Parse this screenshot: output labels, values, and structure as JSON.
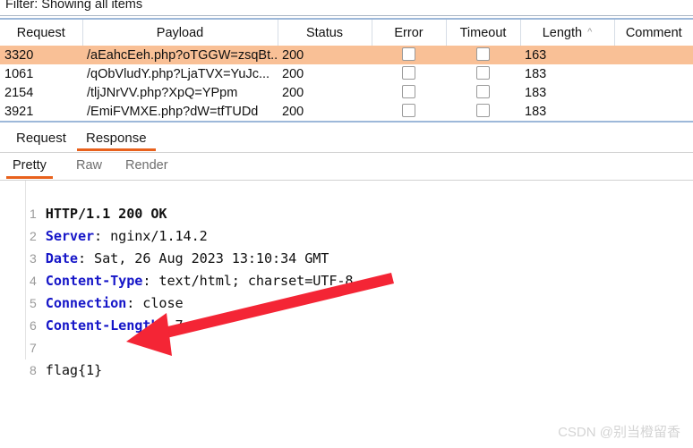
{
  "filter": {
    "text": "Filter: Showing all items"
  },
  "results": {
    "columns": [
      {
        "label": "Request",
        "sort": ""
      },
      {
        "label": "Payload",
        "sort": ""
      },
      {
        "label": "Status",
        "sort": ""
      },
      {
        "label": "Error",
        "sort": ""
      },
      {
        "label": "Timeout",
        "sort": ""
      },
      {
        "label": "Length",
        "sort": "^"
      },
      {
        "label": "Comment",
        "sort": ""
      }
    ],
    "rows": [
      {
        "request": "3320",
        "payload": "/aEahcEeh.php?oTGGW=zsqBt...",
        "status": "200",
        "error": false,
        "timeout": false,
        "length": "163",
        "comment": "",
        "selected": true
      },
      {
        "request": "1061",
        "payload": "/qObVludY.php?LjaTVX=YuJc...",
        "status": "200",
        "error": false,
        "timeout": false,
        "length": "183",
        "comment": "",
        "selected": false
      },
      {
        "request": "2154",
        "payload": "/tljJNrVV.php?XpQ=YPpm",
        "status": "200",
        "error": false,
        "timeout": false,
        "length": "183",
        "comment": "",
        "selected": false
      },
      {
        "request": "3921",
        "payload": "/EmiFVMXE.php?dW=tfTUDd",
        "status": "200",
        "error": false,
        "timeout": false,
        "length": "183",
        "comment": "",
        "selected": false
      }
    ]
  },
  "message_tabs": {
    "request": "Request",
    "response": "Response",
    "active": "Response"
  },
  "view_tabs": {
    "pretty": "Pretty",
    "raw": "Raw",
    "render": "Render",
    "active": "Pretty"
  },
  "response": {
    "lines": [
      {
        "n": "1",
        "kind": "status",
        "text": "HTTP/1.1 200 OK"
      },
      {
        "n": "2",
        "kind": "header",
        "key": "Server",
        "value": " nginx/1.14.2"
      },
      {
        "n": "3",
        "kind": "header",
        "key": "Date",
        "value": " Sat, 26 Aug 2023 13:10:34 GMT"
      },
      {
        "n": "4",
        "kind": "header",
        "key": "Content-Type",
        "value": " text/html; charset=UTF-8"
      },
      {
        "n": "5",
        "kind": "header",
        "key": "Connection",
        "value": " close"
      },
      {
        "n": "6",
        "kind": "header",
        "key": "Content-Length",
        "value": " 7"
      },
      {
        "n": "7",
        "kind": "blank",
        "text": ""
      },
      {
        "n": "8",
        "kind": "body",
        "text": "flag{1}"
      }
    ]
  },
  "annotation": {
    "arrow_color": "#f42535",
    "label": "arrow pointing to flag value"
  },
  "watermark": {
    "text": "CSDN @别当橙留香"
  },
  "colors": {
    "accent": "#e8611c",
    "selected_row": "#f9c096",
    "header_key": "#1616c8",
    "table_border": "#9db8d9"
  }
}
